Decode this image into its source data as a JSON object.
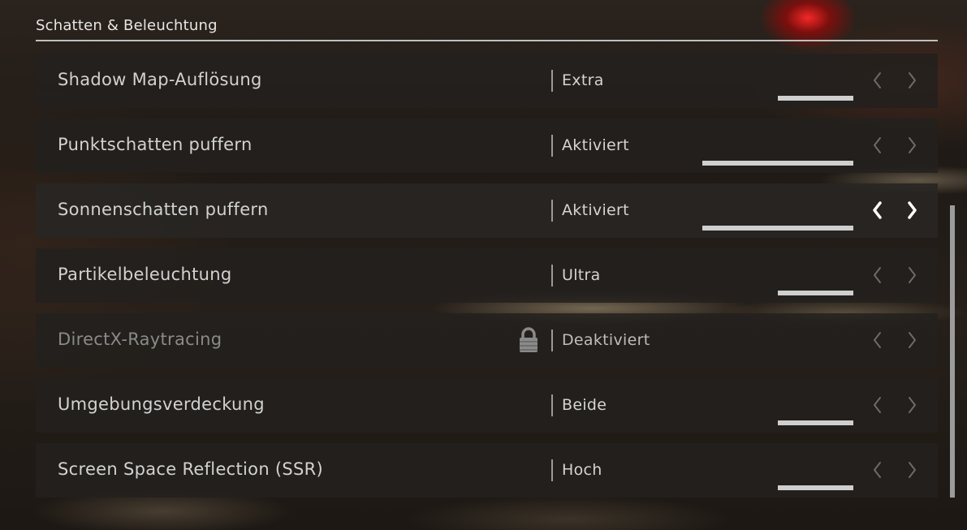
{
  "section": {
    "title": "Schatten & Beleuchtung"
  },
  "settings": [
    {
      "label": "Shadow Map-Auflösung",
      "value": "Extra",
      "level": "5 of 10 steps (short bar)",
      "locked": false,
      "selected": false
    },
    {
      "label": "Punktschatten puffern",
      "value": "Aktiviert",
      "locked": false,
      "selected": false
    },
    {
      "label": "Sonnenschatten puffern",
      "value": "Aktiviert",
      "locked": false,
      "selected": true
    },
    {
      "label": "Partikelbeleuchtung",
      "value": "Ultra",
      "locked": false,
      "selected": false
    },
    {
      "label": "DirectX-Raytracing",
      "value": "Deaktiviert",
      "locked": true,
      "selected": false
    },
    {
      "label": "Umgebungsverdeckung",
      "value": "Beide",
      "locked": false,
      "selected": false
    },
    {
      "label": "Screen Space Reflection (SSR)",
      "value": "Hoch",
      "locked": false,
      "selected": false
    }
  ],
  "icons": {
    "left": "chevron-left-icon",
    "right": "chevron-right-icon",
    "lock": "lock-icon"
  },
  "colors": {
    "accent_white": "#ffffff",
    "arrow_inactive": "#6b6b6b",
    "row_bg": "#22201e",
    "bar": "#cfcfcf"
  }
}
